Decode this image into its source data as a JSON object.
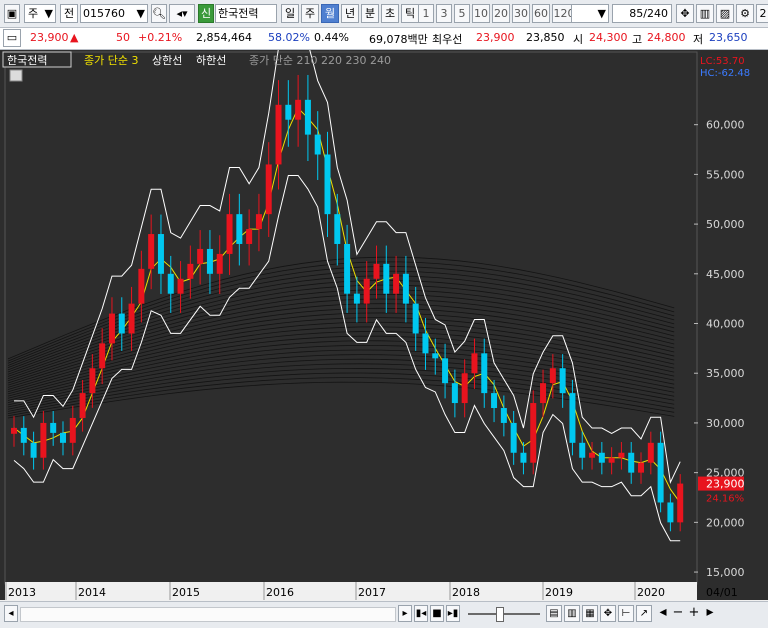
{
  "toolbar": {
    "period_label": "주",
    "market_label": "전",
    "stock_code": "015760",
    "stock_badge": "신",
    "stock_name": "한국전력",
    "period_tabs": [
      "일",
      "주",
      "월",
      "년",
      "분",
      "초",
      "틱"
    ],
    "selected_period": "월",
    "interval_buttons": [
      "1",
      "3",
      "5",
      "10",
      "20",
      "30",
      "60",
      "120"
    ],
    "bar_count": "85",
    "bar_total": "/240",
    "colors": {
      "selected": "#4f7fd0"
    }
  },
  "quote": {
    "price": "23,900",
    "change": "50",
    "change_pct": "+0.21%",
    "volume": "2,854,464",
    "ratio1": "58.02%",
    "ratio2": "0.44%",
    "amount": "69,078백만",
    "preferred_label": "최우선",
    "ask": "23,900",
    "bid": "23,850",
    "open_label": "시",
    "open": "24,300",
    "high_label": "고",
    "high": "24,800",
    "low_label": "저",
    "low": "23,650"
  },
  "legend": {
    "name": "한국전력",
    "ma_label": "종가 단순 3",
    "upper_label": "상한선",
    "lower_label": "하한선",
    "ma_long_label": "종가 단순 210 220 230 240"
  },
  "chart_data": {
    "type": "candlestick",
    "x_tick_labels": [
      "2013",
      "2014",
      "2015",
      "2016",
      "2017",
      "2018",
      "2019",
      "2020",
      "04/01"
    ],
    "y_tick_labels": [
      "15,000",
      "20,000",
      "25,000",
      "30,000",
      "35,000",
      "40,000",
      "45,000",
      "50,000",
      "55,000",
      "60,000"
    ],
    "ylim": [
      14000,
      65500
    ],
    "lc_label": "LC:53.70",
    "hc_label": "HC:-62.48",
    "last_price_label": "23,900",
    "last_pct_label": "24.16%",
    "close_path": [
      29500,
      28000,
      26500,
      30000,
      29000,
      28000,
      30500,
      33000,
      35500,
      38000,
      41000,
      39000,
      42000,
      45500,
      49000,
      45000,
      43000,
      44500,
      46000,
      47500,
      45000,
      47000,
      51000,
      48000,
      49500,
      51000,
      56000,
      62000,
      60500,
      62500,
      59000,
      57000,
      51000,
      48000,
      43000,
      42000,
      44500,
      46000,
      43000,
      45000,
      42000,
      39000,
      37000,
      36500,
      34000,
      32000,
      35000,
      37000,
      33000,
      31500,
      30000,
      27000,
      26000,
      32000,
      34000,
      35500,
      33000,
      28000,
      26500,
      27000,
      26000,
      26500,
      27000,
      25000,
      26000,
      28000,
      22000,
      20000,
      23900
    ],
    "colors": {
      "up": "#e8141e",
      "down": "#00c8f0",
      "ma": "#f0e000",
      "band": "#ffffff",
      "background": "#2d2d2d"
    }
  },
  "bottom": {
    "date_label": "04/01"
  }
}
